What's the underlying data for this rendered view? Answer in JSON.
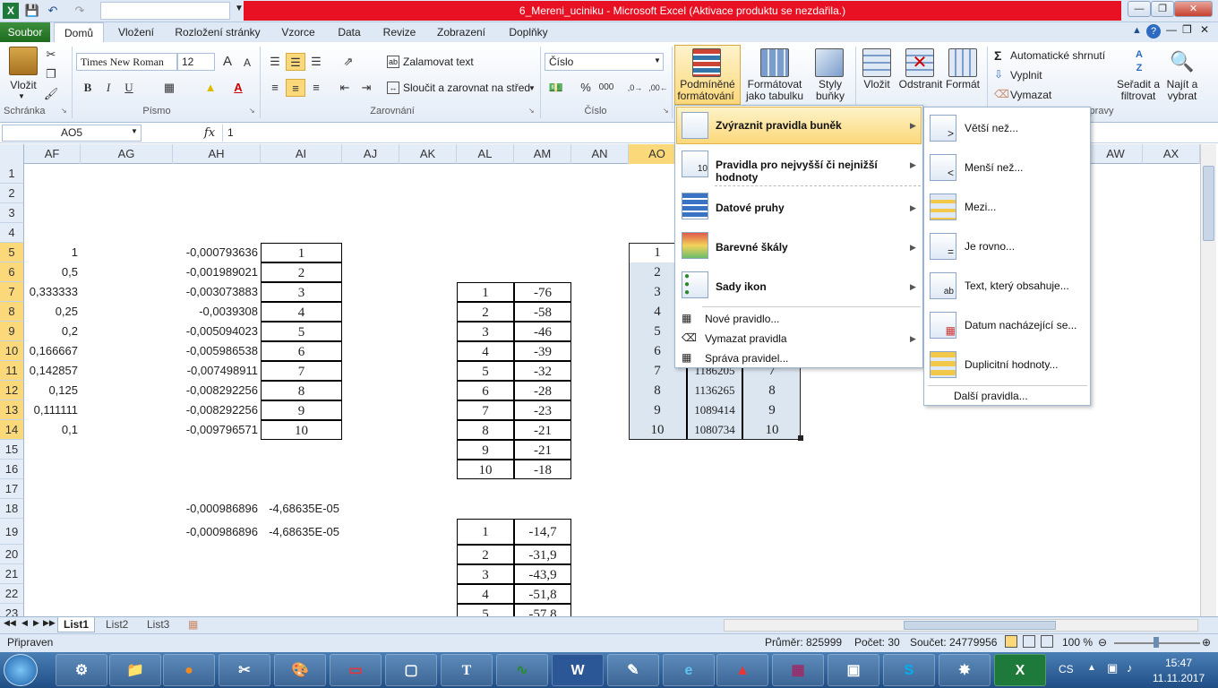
{
  "window": {
    "title": "6_Mereni_uciniku  -  Microsoft Excel (Aktivace produktu se nezdařila.)"
  },
  "tabs": [
    "Soubor",
    "Domů",
    "Vložení",
    "Rozložení stránky",
    "Vzorce",
    "Data",
    "Revize",
    "Zobrazení",
    "Doplňky"
  ],
  "ribbon": {
    "clipboard": {
      "paste": "Vložit",
      "label": "Schránka"
    },
    "font": {
      "name": "Times New Roman",
      "size": "12",
      "bold": "B",
      "italic": "I",
      "underline": "U",
      "grow": "A",
      "shrink": "A",
      "label": "Písmo"
    },
    "alignment": {
      "wrap": "Zalamovat text",
      "merge": "Sloučit a zarovnat na střed",
      "label": "Zarovnání"
    },
    "number": {
      "format": "Číslo",
      "pct": "%",
      "thousands": "000",
      "label": "Číslo"
    },
    "styles": {
      "cond_line1": "Podmíněné",
      "cond_line2": "formátování",
      "table_line1": "Formátovat",
      "table_line2": "jako tabulku",
      "cell_line1": "Styly",
      "cell_line2": "buňky"
    },
    "cells": {
      "insert": "Vložit",
      "delete": "Odstranit",
      "format": "Formát"
    },
    "editing": {
      "autosum": "Automatické shrnutí",
      "fill": "Vyplnit",
      "clear": "Vymazat",
      "sort_line1": "Seřadit a",
      "sort_line2": "filtrovat",
      "find_line1": "Najít a",
      "find_line2": "vybrat",
      "label_tail": "pravy"
    }
  },
  "formula": {
    "namebox": "AO5",
    "fx": "fx",
    "value": "1"
  },
  "columns": [
    "AF",
    "AG",
    "AH",
    "AI",
    "AJ",
    "AK",
    "AL",
    "AM",
    "AN",
    "AO",
    "AW",
    "AX"
  ],
  "rows": [
    "1",
    "2",
    "3",
    "4",
    "5",
    "6",
    "7",
    "8",
    "9",
    "10",
    "11",
    "12",
    "13",
    "14",
    "15",
    "16",
    "17",
    "18",
    "19",
    "20",
    "21",
    "22",
    "23"
  ],
  "col_af": [
    "1",
    "0,5",
    "0,333333",
    "0,25",
    "0,2",
    "0,166667",
    "0,142857",
    "0,125",
    "0,111111",
    "0,1"
  ],
  "col_ah": [
    "-0,000793636",
    "-0,001989021",
    "-0,003073883",
    "-0,0039308",
    "-0,005094023",
    "-0,005986538",
    "-0,007498911",
    "-0,008292256",
    "-0,008292256",
    "-0,009796571"
  ],
  "col_ai": [
    "1",
    "2",
    "3",
    "4",
    "5",
    "6",
    "7",
    "8",
    "9",
    "10"
  ],
  "row18": {
    "ah": "-0,000986896",
    "ai": "-4,68635E-05"
  },
  "row19": {
    "ah": "-0,000986896",
    "ai": "-4,68635E-05"
  },
  "table1": {
    "al": [
      "1",
      "2",
      "3",
      "4",
      "5",
      "6",
      "7",
      "8",
      "9",
      "10"
    ],
    "am": [
      "-76",
      "-58",
      "-46",
      "-39",
      "-32",
      "-28",
      "-23",
      "-21",
      "-21",
      "-18"
    ]
  },
  "table2": {
    "al": [
      "1",
      "2",
      "3",
      "4",
      "5"
    ],
    "am": [
      "-14,7",
      "-31,9",
      "-43,9",
      "-51,8",
      "-57,8"
    ]
  },
  "table3": {
    "ao": [
      "1",
      "2",
      "3",
      "4",
      "5",
      "6",
      "7",
      "8",
      "9",
      "10"
    ],
    "ap_visible": [
      "1186205",
      "1136265",
      "1089414",
      "1080734"
    ],
    "aq_visible": [
      "7",
      "8",
      "9",
      "10"
    ]
  },
  "menu1": {
    "items": [
      "Zvýraznit pravidla buněk",
      "Pravidla pro nejvyšší či nejnižší hodnoty",
      "Datové pruhy",
      "Barevné škály",
      "Sady ikon"
    ],
    "small": [
      "Nové pravidlo...",
      "Vymazat pravidla",
      "Správa pravidel..."
    ]
  },
  "menu2": {
    "items": [
      "Větší než...",
      "Menší než...",
      "Mezi...",
      "Je rovno...",
      "Text, který obsahuje...",
      "Datum nacházející se...",
      "Duplicitní hodnoty..."
    ],
    "more": "Další pravidla..."
  },
  "sheets": [
    "List1",
    "List2",
    "List3"
  ],
  "status": {
    "ready": "Připraven",
    "avg": "Průměr: 825999",
    "count": "Počet: 30",
    "sum": "Součet: 24779956",
    "zoom": "100 %"
  },
  "taskbar": {
    "lang": "CS",
    "time": "15:47",
    "date": "11.11.2017"
  },
  "colors": {
    "file_tab": "#2a7d2a",
    "title_highlight": "#e81123",
    "selection": "#dce6f1",
    "menu_hover": "#fbe9a8"
  }
}
